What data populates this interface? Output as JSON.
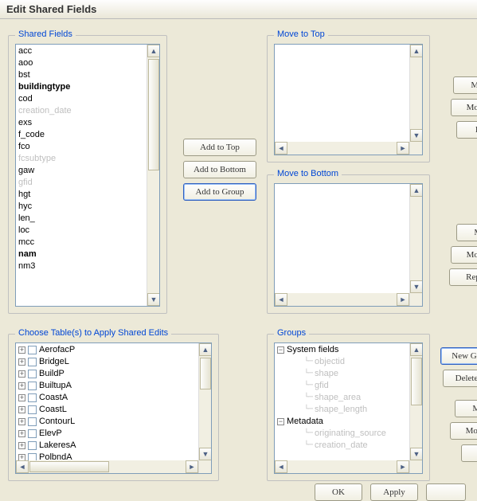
{
  "dialog_title": "Edit Shared Fields",
  "shared_fields": {
    "legend": "Shared Fields",
    "items": [
      {
        "label": "acc",
        "style": "normal"
      },
      {
        "label": "aoo",
        "style": "normal"
      },
      {
        "label": "bst",
        "style": "normal"
      },
      {
        "label": "buildingtype",
        "style": "bold"
      },
      {
        "label": "cod",
        "style": "normal"
      },
      {
        "label": "creation_date",
        "style": "disabled"
      },
      {
        "label": "exs",
        "style": "normal"
      },
      {
        "label": "f_code",
        "style": "normal"
      },
      {
        "label": "fco",
        "style": "normal"
      },
      {
        "label": "fcsubtype",
        "style": "disabled"
      },
      {
        "label": "gaw",
        "style": "normal"
      },
      {
        "label": "gfid",
        "style": "disabled"
      },
      {
        "label": "hgt",
        "style": "normal"
      },
      {
        "label": "hyc",
        "style": "normal"
      },
      {
        "label": "len_",
        "style": "normal"
      },
      {
        "label": "loc",
        "style": "normal"
      },
      {
        "label": "mcc",
        "style": "normal"
      },
      {
        "label": "nam",
        "style": "bold"
      },
      {
        "label": "nm3",
        "style": "normal"
      }
    ]
  },
  "center_buttons": {
    "add_to_top": "Add to Top",
    "add_to_bottom": "Add to Bottom",
    "add_to_group": "Add to Group"
  },
  "move_to_top": {
    "legend": "Move to Top"
  },
  "move_to_bottom": {
    "legend": "Move to Bottom"
  },
  "groups": {
    "legend": "Groups",
    "nodes": [
      {
        "label": "System fields",
        "expanded": true,
        "children": [
          {
            "label": "objectid",
            "strike": true
          },
          {
            "label": "shape"
          },
          {
            "label": "gfid"
          },
          {
            "label": "shape_area"
          },
          {
            "label": "shape_length"
          }
        ]
      },
      {
        "label": "Metadata",
        "expanded": true,
        "children": [
          {
            "label": "originating_source"
          },
          {
            "label": "creation_date"
          }
        ]
      }
    ]
  },
  "tables": {
    "legend": "Choose Table(s) to Apply Shared Edits",
    "items": [
      "AerofacP",
      "BridgeL",
      "BuildP",
      "BuiltupA",
      "CoastA",
      "CoastL",
      "ContourL",
      "ElevP",
      "LakeresA",
      "PolbndA"
    ]
  },
  "side_buttons_top": [
    "Mo",
    "Mov",
    "Re"
  ],
  "side_buttons_mid": [
    "Mo",
    "Mov",
    "Rep"
  ],
  "side_buttons_groups": [
    "New G",
    "Delete",
    "Mo",
    "Mov",
    "R"
  ],
  "bottom_buttons": {
    "ok": "OK",
    "apply": "Apply"
  }
}
